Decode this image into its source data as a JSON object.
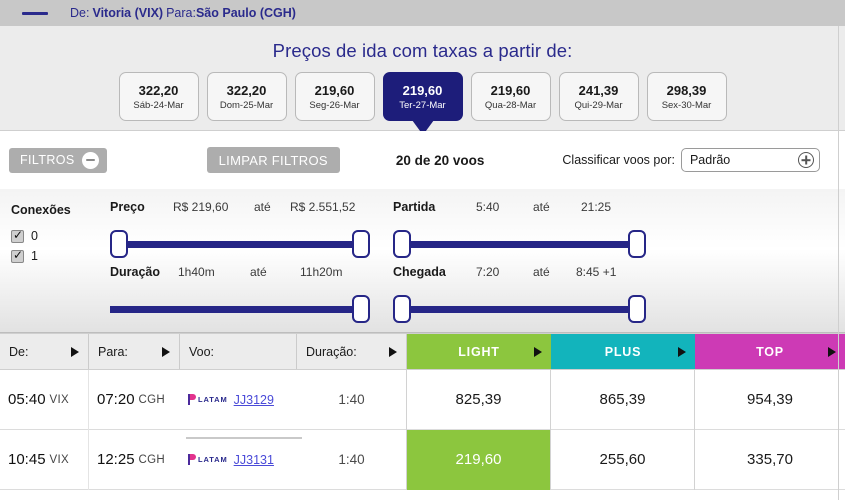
{
  "route": {
    "from_label": "De:",
    "from_value": "Vitoria (VIX)",
    "to_label": "Para:",
    "to_value": "São Paulo (CGH)",
    "divider_icon": "dash-icon"
  },
  "price_strip": {
    "title": "Preços de ida com taxas a partir de:",
    "tabs": [
      {
        "price": "322,20",
        "day": "Sáb-24-Mar",
        "selected": false
      },
      {
        "price": "322,20",
        "day": "Dom-25-Mar",
        "selected": false
      },
      {
        "price": "219,60",
        "day": "Seg-26-Mar",
        "selected": false
      },
      {
        "price": "219,60",
        "day": "Ter-27-Mar",
        "selected": true
      },
      {
        "price": "219,60",
        "day": "Qua-28-Mar",
        "selected": false
      },
      {
        "price": "241,39",
        "day": "Qui-29-Mar",
        "selected": false
      },
      {
        "price": "298,39",
        "day": "Sex-30-Mar",
        "selected": false
      }
    ]
  },
  "filter_bar": {
    "filtros_label": "FILTROS",
    "filtros_icon": "minus-circle-icon",
    "limpar_label": "LIMPAR FILTROS",
    "count_label": "20 de 20 voos",
    "sort_label": "Classificar voos por:",
    "sort_value": "Padrão",
    "sort_icon": "plus-circle-icon"
  },
  "filter_panel": {
    "conexoes_title": "Conexões",
    "conexoes": [
      {
        "label": "0",
        "checked": true
      },
      {
        "label": "1",
        "checked": true
      }
    ],
    "sliders": [
      {
        "name": "Preço",
        "min": "R$ 219,60",
        "ate": "até",
        "max": "R$ 2.551,52"
      },
      {
        "name": "Duração",
        "min": "1h40m",
        "ate": "até",
        "max": "11h20m"
      },
      {
        "name": "Partida",
        "min": "5:40",
        "ate": "até",
        "max": "21:25"
      },
      {
        "name": "Chegada",
        "min": "7:20",
        "ate": "até",
        "max": "8:45 +1"
      }
    ]
  },
  "results": {
    "columns": [
      {
        "label": "De:",
        "caret": true
      },
      {
        "label": "Para:",
        "caret": true
      },
      {
        "label": "Voo:",
        "caret": false
      },
      {
        "label": "Duração:",
        "caret": true
      },
      {
        "label": "LIGHT",
        "caret": true,
        "color": "#8cc63e"
      },
      {
        "label": "PLUS",
        "caret": true,
        "color": "#12b4bc"
      },
      {
        "label": "TOP",
        "caret": true,
        "color": "#cd3ab5"
      }
    ],
    "rows": [
      {
        "dep_time": "05:40",
        "dep_apt": "VIX",
        "arr_time": "07:20",
        "arr_apt": "CGH",
        "airline": "LATAM",
        "flight_no": "JJ3129",
        "duration": "1:40",
        "price_light": "825,39",
        "price_plus": "865,39",
        "price_top": "954,39",
        "light_highlighted": false
      },
      {
        "dep_time": "10:45",
        "dep_apt": "VIX",
        "arr_time": "12:25",
        "arr_apt": "CGH",
        "airline": "LATAM",
        "flight_no": "JJ3131",
        "duration": "1:40",
        "price_light": "219,60",
        "price_plus": "255,60",
        "price_top": "335,70",
        "light_highlighted": true
      }
    ]
  },
  "colors": {
    "brand_navy": "#2a2a8c",
    "selected_tab": "#1d1d7a",
    "light_green": "#8cc63e",
    "plus_teal": "#12b4bc",
    "top_magenta": "#cd3ab5",
    "slider_bar": "#262687"
  }
}
